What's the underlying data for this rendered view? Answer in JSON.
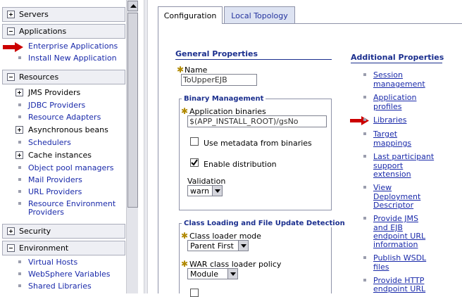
{
  "nav": {
    "sections": {
      "servers": "Servers",
      "applications": "Applications",
      "resources": "Resources",
      "security": "Security",
      "environment": "Environment"
    },
    "applications_items": [
      "Enterprise Applications",
      "Install New Application"
    ],
    "resources_items": {
      "jms": "JMS Providers",
      "jdbc": "JDBC Providers",
      "adapters": "Resource Adapters",
      "async": "Asynchronous beans",
      "schedulers": "Schedulers",
      "cache": "Cache instances",
      "object_pool": "Object pool managers",
      "mail": "Mail Providers",
      "url": "URL Providers",
      "rep1": "Resource Environment",
      "rep2": "Providers"
    },
    "environment_items": [
      "Virtual Hosts",
      "WebSphere Variables",
      "Shared Libraries"
    ]
  },
  "tabs": {
    "configuration": "Configuration",
    "local_topology": "Local Topology"
  },
  "general": {
    "heading": "General Properties",
    "name_label": "Name",
    "name_value": "ToUpperEJB",
    "binary_legend": "Binary Management",
    "app_binaries_label": "Application binaries",
    "app_binaries_value": "$(APP_INSTALL_ROOT)/gsNo",
    "use_metadata_label": "Use metadata from binaries",
    "use_metadata_checked": false,
    "enable_distribution_label": "Enable distribution",
    "enable_distribution_checked": true,
    "validation_label": "Validation",
    "validation_value": "warn",
    "classloading_legend": "Class Loading and File Update Detection",
    "class_loader_mode_label": "Class loader mode",
    "class_loader_mode_value": "Parent First",
    "war_policy_label": "WAR class loader policy",
    "war_policy_value": "Module"
  },
  "additional": {
    "heading": "Additional Properties",
    "session": [
      "Session",
      "management"
    ],
    "app_profiles": [
      "Application",
      "profiles"
    ],
    "libraries": "Libraries",
    "target": [
      "Target",
      "mappings"
    ],
    "last_participant": [
      "Last participant",
      "support",
      "extension"
    ],
    "view_deploy": [
      "View",
      "Deployment",
      "Descriptor"
    ],
    "provide_jms": [
      "Provide JMS",
      "and EJB",
      "endpoint URL",
      "information"
    ],
    "publish_wsdl": [
      "Publish WSDL",
      "files"
    ],
    "provide_http": [
      "Provide HTTP",
      "endpoint URL"
    ]
  },
  "colors": {
    "link": "#1a2aaa",
    "heading": "#1b2f8e",
    "arrow": "#cc0000",
    "required": "#b08800"
  }
}
